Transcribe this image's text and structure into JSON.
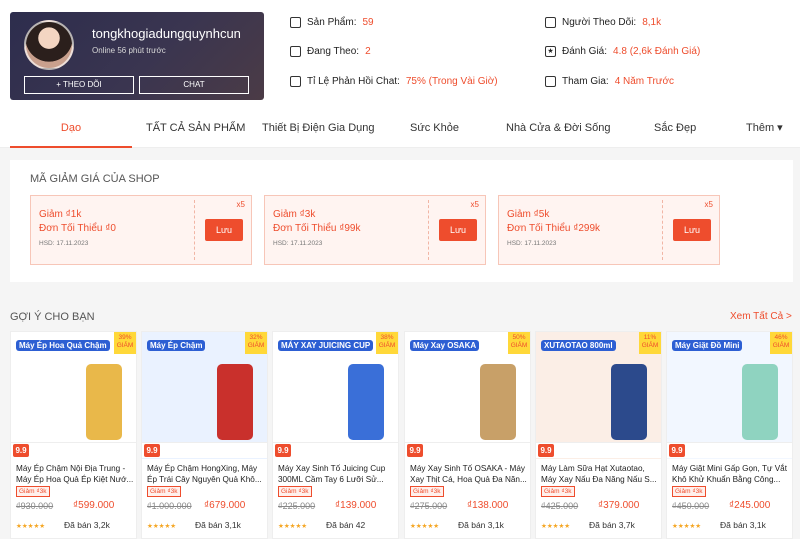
{
  "shop": {
    "name": "tongkhogiadungquynhcun",
    "status": "Online 56 phút trước",
    "follow_label": "+ THEO DÕI",
    "chat_label": "CHAT"
  },
  "stats": [
    {
      "label": "Sản Phẩm:",
      "value": "59",
      "icon": "store-icon"
    },
    {
      "label": "Người Theo Dõi:",
      "value": "8,1k",
      "icon": "followers-icon"
    },
    {
      "label": "Đang Theo:",
      "value": "2",
      "icon": "user-icon"
    },
    {
      "label": "Đánh Giá:",
      "value": "4.8 (2,6k Đánh Giá)",
      "icon": "star-icon"
    },
    {
      "label": "Tỉ Lệ Phản Hồi Chat:",
      "value": "75% (Trong Vài Giờ)",
      "icon": "chat-icon"
    },
    {
      "label": "Tham Gia:",
      "value": "4 Năm Trước",
      "icon": "user-join-icon"
    }
  ],
  "tabs": [
    "Dạo",
    "TẤT CẢ SẢN PHẨM",
    "Thiết Bị Điện Gia Dụng",
    "Sức Khỏe",
    "Nhà Cửa & Đời Sống",
    "Sắc Đẹp",
    "Thêm ▾"
  ],
  "vouchers": {
    "title": "MÃ GIẢM GIÁ CỦA SHOP",
    "items": [
      {
        "discount": "Giảm ₫1k",
        "min": "Đơn Tối Thiểu ₫0",
        "expiry": "HSD: 17.11.2023",
        "qty": "x5",
        "save": "Lưu"
      },
      {
        "discount": "Giảm ₫3k",
        "min": "Đơn Tối Thiểu ₫99k",
        "expiry": "HSD: 17.11.2023",
        "qty": "x5",
        "save": "Lưu"
      },
      {
        "discount": "Giảm ₫5k",
        "min": "Đơn Tối Thiểu ₫299k",
        "expiry": "HSD: 17.11.2023",
        "qty": "x5",
        "save": "Lưu"
      }
    ]
  },
  "recommend": {
    "title": "GỢI Ý CHO BẠN",
    "see_all": "Xem Tất Cả >",
    "products": [
      {
        "name": "Máy Ép Chậm Nội Địa Trung - Máy Ép Hoa Quả Ép Kiệt Nướ...",
        "badge": "39% GIẢM",
        "tag": "Máy Ép Hoa Quả Chậm",
        "discount": "Giảm ₫3k",
        "old": "₫930.000",
        "price": "₫599.000",
        "sold": "Đã bán 3,2k",
        "color": "#e9b84a"
      },
      {
        "name": "Máy Ép Chậm HongXing, Máy Ép Trái Cây Nguyên Quả Khô...",
        "badge": "32% GIẢM",
        "tag": "Máy Ép Chậm",
        "discount": "Giảm ₫3k",
        "old": "₫1.000.000",
        "price": "₫679.000",
        "sold": "Đã bán 3,1k",
        "color": "#c9302c"
      },
      {
        "name": "Máy Xay Sinh Tố Juicing Cup 300ML Cầm Tay 6 Lưỡi Sử...",
        "badge": "38% GIẢM",
        "tag": "MÁY XAY JUICING CUP",
        "discount": "Giảm ₫3k",
        "old": "₫225.000",
        "price": "₫139.000",
        "sold": "Đã bán 42",
        "color": "#3a6fd8"
      },
      {
        "name": "Máy Xay Sinh Tố OSAKA - Máy Xay Thịt Cá, Hoa Quả Đa Năn...",
        "badge": "50% GIẢM",
        "tag": "Máy Xay OSAKA",
        "discount": "Giảm ₫3k",
        "old": "₫275.000",
        "price": "₫138.000",
        "sold": "Đã bán 3,1k",
        "color": "#c8a068"
      },
      {
        "name": "Máy Làm Sữa Hạt Xutaotao, Máy Xay Nấu Đa Năng Nấu S...",
        "badge": "11% GIẢM",
        "tag": "XUTAOTAO 800ml",
        "discount": "Giảm ₫3k",
        "old": "₫425.000",
        "price": "₫379.000",
        "sold": "Đã bán 3,7k",
        "color": "#2c4a8c"
      },
      {
        "name": "Máy Giặt Mini Gấp Gọn, Tự Vắt Khô Khử Khuẩn Bằng Công...",
        "badge": "46% GIẢM",
        "tag": "Máy Giặt Đồ Mini",
        "discount": "Giảm ₫3k",
        "old": "₫450.000",
        "price": "₫245.000",
        "sold": "Đã bán 3,1k",
        "color": "#8fd3c0"
      }
    ]
  }
}
